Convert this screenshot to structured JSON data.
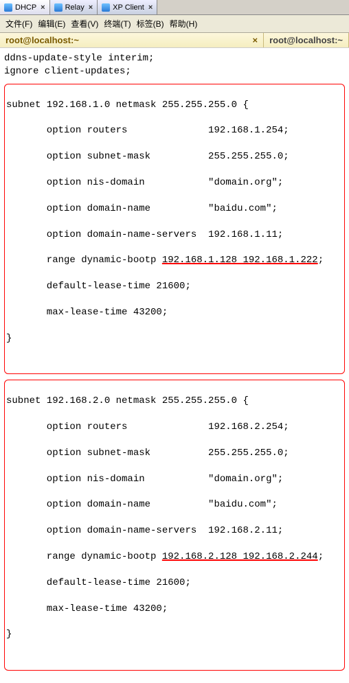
{
  "tabs": [
    {
      "label": "DHCP",
      "close": "×"
    },
    {
      "label": "Relay",
      "close": "×"
    },
    {
      "label": "XP Client",
      "close": "×"
    }
  ],
  "menu": {
    "file": "文件(F)",
    "edit": "编辑(E)",
    "view": "查看(V)",
    "terminal": "终端(T)",
    "tabs": "标签(B)",
    "help": "帮助(H)"
  },
  "sub_tabs": [
    {
      "label": "root@localhost:~",
      "close": "×"
    },
    {
      "label": "root@localhost:~"
    }
  ],
  "header_lines": [
    "ddns-update-style interim;",
    "ignore client-updates;"
  ],
  "subnets": [
    {
      "decl": "subnet 192.168.1.0 netmask 255.255.255.0 {",
      "opts": [
        {
          "key": "       option routers",
          "val": "              192.168.1.254;"
        },
        {
          "key": "       option subnet-mask",
          "val": "          255.255.255.0;"
        },
        {
          "key": "       option nis-domain",
          "val": "           \"domain.org\";"
        },
        {
          "key": "       option domain-name",
          "val": "          \"baidu.com\";"
        },
        {
          "key": "       option domain-name-servers",
          "val": "  192.168.1.11;"
        }
      ],
      "range_prefix": "       range dynamic-bootp ",
      "range_underlined": "192.168.1.128 192.168.1.222",
      "range_suffix": ";",
      "default_lease": "       default-lease-time 21600;",
      "max_lease": "       max-lease-time 43200;",
      "close": "}"
    },
    {
      "decl": "subnet 192.168.2.0 netmask 255.255.255.0 {",
      "opts": [
        {
          "key": "       option routers",
          "val": "              192.168.2.254;"
        },
        {
          "key": "       option subnet-mask",
          "val": "          255.255.255.0;"
        },
        {
          "key": "       option nis-domain",
          "val": "           \"domain.org\";"
        },
        {
          "key": "       option domain-name",
          "val": "          \"baidu.com\";"
        },
        {
          "key": "       option domain-name-servers",
          "val": "  192.168.2.11;"
        }
      ],
      "range_prefix": "       range dynamic-bootp ",
      "range_underlined": "192.168.2.128 192.168.2.244",
      "range_suffix": ";",
      "default_lease": "       default-lease-time 21600;",
      "max_lease": "       max-lease-time 43200;",
      "close": "}"
    }
  ]
}
